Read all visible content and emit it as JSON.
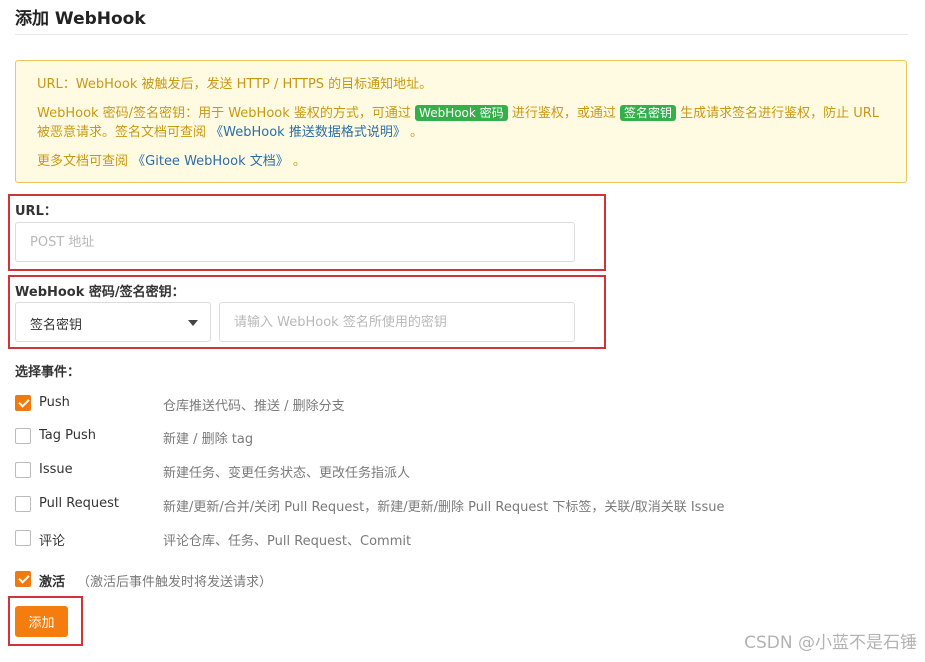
{
  "page": {
    "title": "添加 WebHook"
  },
  "notice": {
    "url_line": "URL：WebHook 被触发后，发送 HTTP / HTTPS 的目标通知地址。",
    "secret_line_a": "WebHook 密码/签名密钥：用于 WebHook 鉴权的方式，可通过",
    "secret_tag_1": "WebHook 密码",
    "secret_line_b": "进行鉴权，或通过",
    "secret_tag_2": "签名密钥",
    "secret_line_c": "生成请求签名进行鉴权，防止 URL 被恶意请求。签名文档可查阅",
    "secret_link": "《WebHook 推送数据格式说明》",
    "secret_line_end": "。",
    "more_docs_prefix": "更多文档可查阅",
    "more_docs_link": "《Gitee WebHook 文档》",
    "more_docs_end": "。"
  },
  "form": {
    "url_label": "URL：",
    "url_placeholder": "POST 地址",
    "secret_label": "WebHook 密码/签名密钥：",
    "secret_type_selected": "签名密钥",
    "secret_placeholder": "请输入 WebHook 签名所使用的密钥"
  },
  "events": {
    "label": "选择事件：",
    "items": [
      {
        "name": "Push",
        "desc": "仓库推送代码、推送 / 删除分支",
        "checked": true
      },
      {
        "name": "Tag Push",
        "desc": "新建 / 删除 tag",
        "checked": false
      },
      {
        "name": "Issue",
        "desc": "新建任务、变更任务状态、更改任务指派人",
        "checked": false
      },
      {
        "name": "Pull Request",
        "desc": "新建/更新/合并/关闭 Pull Request，新建/更新/删除 Pull Request 下标签，关联/取消关联 Issue",
        "checked": false
      },
      {
        "name": "评论",
        "desc": "评论仓库、任务、Pull Request、Commit",
        "checked": false
      }
    ]
  },
  "active": {
    "label": "激活",
    "hint": "（激活后事件触发时将发送请求）",
    "checked": true
  },
  "submit": {
    "label": "添加"
  },
  "watermark": "CSDN @小蓝不是石锤"
}
